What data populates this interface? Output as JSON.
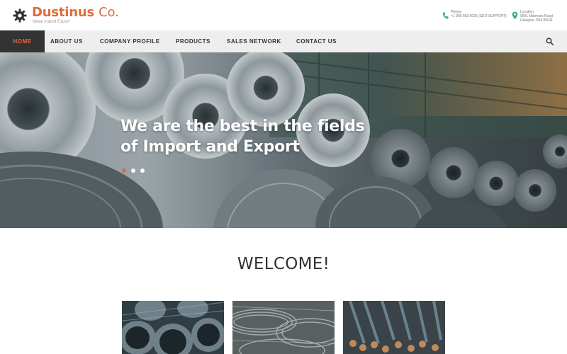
{
  "brand": {
    "name": "Dustinus",
    "suffix": "Co.",
    "tagline": "Metal Import Export",
    "accent_color": "#e06a3b"
  },
  "header": {
    "phone": {
      "label": "Phone:",
      "value": "+1 959 603 6035 (SEO-SUPPORT)",
      "icon": "phone-icon"
    },
    "location": {
      "label": "Location:",
      "line1": "9901 Marmora Road",
      "line2": "Glasgow, D04 89GR",
      "icon": "map-pin-icon"
    }
  },
  "nav": {
    "items": [
      {
        "label": "HOME",
        "active": true
      },
      {
        "label": "ABOUT US",
        "active": false
      },
      {
        "label": "COMPANY PROFILE",
        "active": false
      },
      {
        "label": "PRODUCTS",
        "active": false
      },
      {
        "label": "SALES NETWORK",
        "active": false
      },
      {
        "label": "CONTACT US",
        "active": false
      }
    ],
    "search_icon": "search-icon"
  },
  "hero": {
    "title": "We are the best in the fields of Import and Export",
    "slide_count": 3,
    "active_slide": 1
  },
  "welcome": {
    "heading": "WELCOME!"
  },
  "products": [
    {
      "image": "steel-pipes"
    },
    {
      "image": "steel-wire-coils"
    },
    {
      "image": "rebar-bundles"
    }
  ]
}
